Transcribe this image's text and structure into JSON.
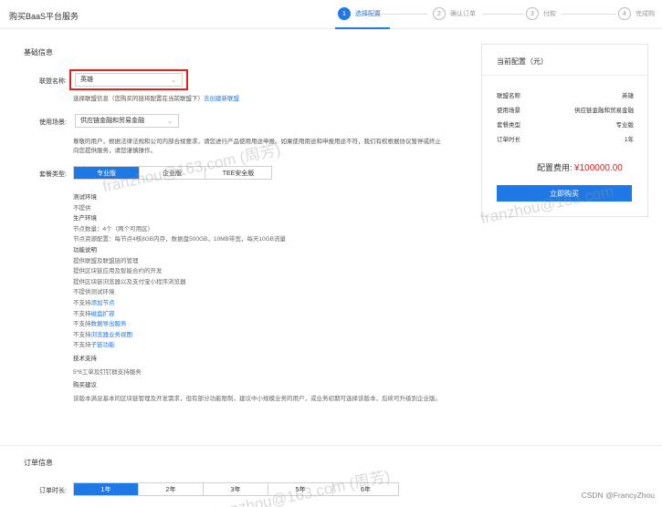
{
  "header": {
    "title": "购买BaaS平台服务",
    "steps": [
      {
        "num": "1",
        "label": "选择配置"
      },
      {
        "num": "2",
        "label": "确认订单"
      },
      {
        "num": "3",
        "label": "付款"
      },
      {
        "num": "4",
        "label": "完成购"
      }
    ]
  },
  "basic": {
    "section_title": "基础信息",
    "alliance_label": "联盟名称:",
    "alliance_value": "英雄",
    "alliance_hint": "选择联盟信息（您购买的链将配置在当前联盟下）",
    "alliance_link": "去创建新联盟",
    "scene_label": "使用场景:",
    "scene_value": "供应链金融和贸易金融",
    "scene_hint_1": "尊敬的用户，根据法律法规和公司内部合规要求，请您进行产品使用用途申报。如果使用用途和申报用途不符，我们有权根据协议暂停或终止",
    "scene_hint_2": "向您提供服务，请您谨慎操作。",
    "package_label": "套餐类型:",
    "packages": [
      "专业版",
      "企业版",
      "TEE安全版"
    ]
  },
  "details": {
    "test_env": "测试环境",
    "test_env_value": "不提供",
    "prod_env": "生产环境",
    "nodes": "节点数量：4个（两个可用区）",
    "resource": "节点资源配置：每节点4核8GB内存，数据盘500GB，10MB带宽，每天10GB流量",
    "features": "功能说明",
    "f1": "提供联盟及联盟链的管理",
    "f2": "提供区块链应用及智能合约的开发",
    "f3": "提供区块链浏览器以及支付宝小程序浏览器",
    "f4": "不提供测试环境",
    "f5_a": "不支持",
    "f5_b": "添加节点",
    "f6_a": "不支持",
    "f6_b": "磁盘扩容",
    "f7_a": "不支持",
    "f7_b": "数据导出服务",
    "f8_a": "不支持",
    "f8_b": "浏览器业务视图",
    "f9_a": "不支持",
    "f9_b": "子链功能",
    "support": "技术支持",
    "support_value": "5*8工单及钉钉群支持服务",
    "advice": "购买建议",
    "advice_value": "该版本满足基本的区块链管理及开发需求，但有部分功能限制，建议中小规模业务的用户，或业务初期可选择该版本，后续可升级到企业版。"
  },
  "order": {
    "section_title": "订单信息",
    "duration_label": "订单时长:",
    "durations": [
      "1年",
      "2年",
      "3年",
      "5年",
      "6年"
    ]
  },
  "panel": {
    "title": "当前配置（元）",
    "rows": [
      {
        "k": "联盟名称",
        "v": "英雄"
      },
      {
        "k": "使用场景",
        "v": "供应链金融和贸易金融"
      },
      {
        "k": "套餐类型",
        "v": "专业版"
      },
      {
        "k": "订单时长",
        "v": "1年"
      }
    ],
    "fee_label": "配置费用:",
    "fee_value": "¥100000.00",
    "buy_label": "立即购买"
  },
  "watermark": {
    "text": "franzhou@163.com (周芳)",
    "short": "franzhou@163.com"
  },
  "footer": {
    "credit": "CSDN @FrancyZhou"
  }
}
